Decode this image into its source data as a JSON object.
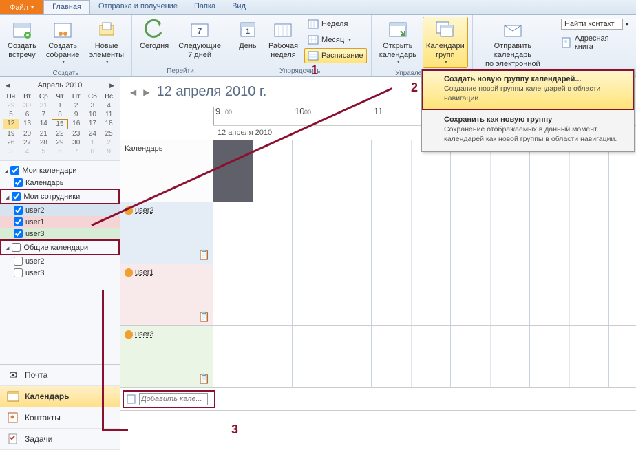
{
  "tabs": {
    "file": "Файл",
    "home": "Главная",
    "sendrecv": "Отправка и получение",
    "folder": "Папка",
    "view": "Вид"
  },
  "ribbon": {
    "create": {
      "meeting": "Создать\nвстречу",
      "meeting_group": "Создать\nсобрание",
      "elements": "Новые\nэлементы",
      "label": "Создать"
    },
    "goto": {
      "today": "Сегодня",
      "next7": "Следующие\n7 дней",
      "label": "Перейти"
    },
    "arrange": {
      "day": "День",
      "workweek": "Рабочая\nнеделя",
      "week": "Неделя",
      "month": "Месяц",
      "schedule": "Расписание",
      "label": "Упорядочить"
    },
    "manage": {
      "open": "Открыть\nкалендарь",
      "groups": "Календари\nгрупп",
      "label": "Управление ка..."
    },
    "share": {
      "email": "Отправить календарь\nпо электронной почте"
    },
    "find": {
      "contact": "Найти контакт",
      "book": "Адресная книга"
    }
  },
  "dropdown": {
    "item1": {
      "title": "Создать новую группу календарей...",
      "desc": "Создание новой группы календарей в области навигации."
    },
    "item2": {
      "title": "Сохранить как новую группу",
      "desc": "Сохранение отображаемых в данный момент календарей как новой группы в области навигации."
    }
  },
  "minical": {
    "title": "Апрель 2010",
    "days": [
      "Пн",
      "Вт",
      "Ср",
      "Чт",
      "Пт",
      "Сб",
      "Вс"
    ]
  },
  "groups": {
    "my": "Мои календари",
    "my_cal": "Календарь",
    "coworkers": "Мои сотрудники",
    "u1": "user2",
    "u2": "user1",
    "u3": "user3",
    "shared": "Общие календари",
    "s1": "user2",
    "s2": "user3"
  },
  "nav": {
    "mail": "Почта",
    "calendar": "Календарь",
    "contacts": "Контакты",
    "tasks": "Задачи"
  },
  "content": {
    "date": "12 апреля 2010 г.",
    "daylabel": "12 апреля 2010 г.",
    "h9": "9",
    "h10": "10",
    "h11": "11",
    "min": "00",
    "row_cal": "Календарь",
    "row_u1": "user2",
    "row_u2": "user1",
    "row_u3": "user3",
    "add_placeholder": "Добавить кале..."
  },
  "ann": {
    "n1": "1",
    "n2": "2",
    "n3": "3"
  }
}
